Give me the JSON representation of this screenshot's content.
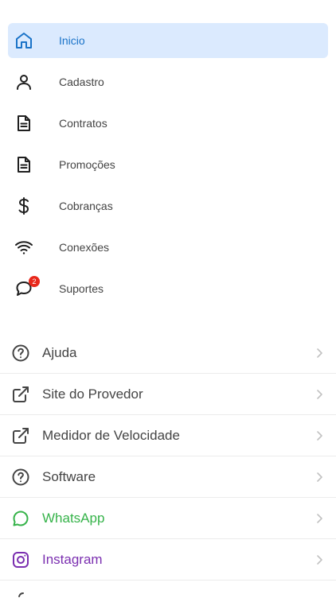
{
  "menu": {
    "items": [
      {
        "label": "Inicio",
        "icon": "home-icon",
        "active": true
      },
      {
        "label": "Cadastro",
        "icon": "user-icon"
      },
      {
        "label": "Contratos",
        "icon": "document-icon"
      },
      {
        "label": "Promoções",
        "icon": "document-icon"
      },
      {
        "label": "Cobranças",
        "icon": "dollar-icon"
      },
      {
        "label": "Conexões",
        "icon": "wifi-icon"
      },
      {
        "label": "Suportes",
        "icon": "chat-icon",
        "badge": "2"
      }
    ]
  },
  "links": {
    "items": [
      {
        "label": "Ajuda",
        "icon": "help-circle-icon"
      },
      {
        "label": "Site do Provedor",
        "icon": "external-link-icon"
      },
      {
        "label": "Medidor de Velocidade",
        "icon": "external-link-icon"
      },
      {
        "label": "Software",
        "icon": "help-circle-icon"
      },
      {
        "label": "WhatsApp",
        "icon": "whatsapp-icon",
        "color": "#36b34a"
      },
      {
        "label": "Instagram",
        "icon": "instagram-icon",
        "color": "#7b2fb0"
      }
    ]
  },
  "colors": {
    "accent": "#1a73c8",
    "active_bg": "#dbeafe",
    "badge": "#e8281b"
  }
}
